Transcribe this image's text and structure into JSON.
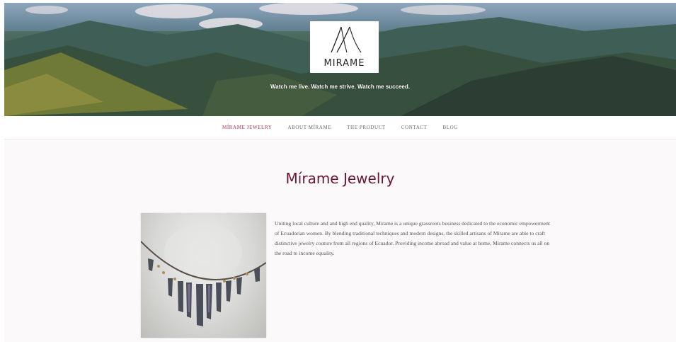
{
  "header": {
    "logo_text": "MIRAME",
    "tagline": "Watch me live. Watch me strive. Watch me succeed."
  },
  "nav": {
    "items": [
      {
        "label": "MÍRAME JEWELRY",
        "active": true
      },
      {
        "label": "ABOUT MÍRAME",
        "active": false
      },
      {
        "label": "THE PRODUCT",
        "active": false
      },
      {
        "label": "CONTACT",
        "active": false
      },
      {
        "label": "BLOG",
        "active": false
      }
    ]
  },
  "main": {
    "title": "Mírame Jewelry",
    "body": "Uniting local culture and and high end quality, Mirame is a unique grassroots business dedicated to the economic empowerment of Ecuadorian women. By blending traditional techniques and modern designs, the skilled artisans of Mirame are able to craft distinctive jewelry couture from all regions of Ecuador. Providing income abroad and value at home, Mirame connects us all on the road to income equality."
  },
  "colors": {
    "accent": "#b2304d",
    "title": "#6b1530",
    "background": "#fbf9fa"
  }
}
